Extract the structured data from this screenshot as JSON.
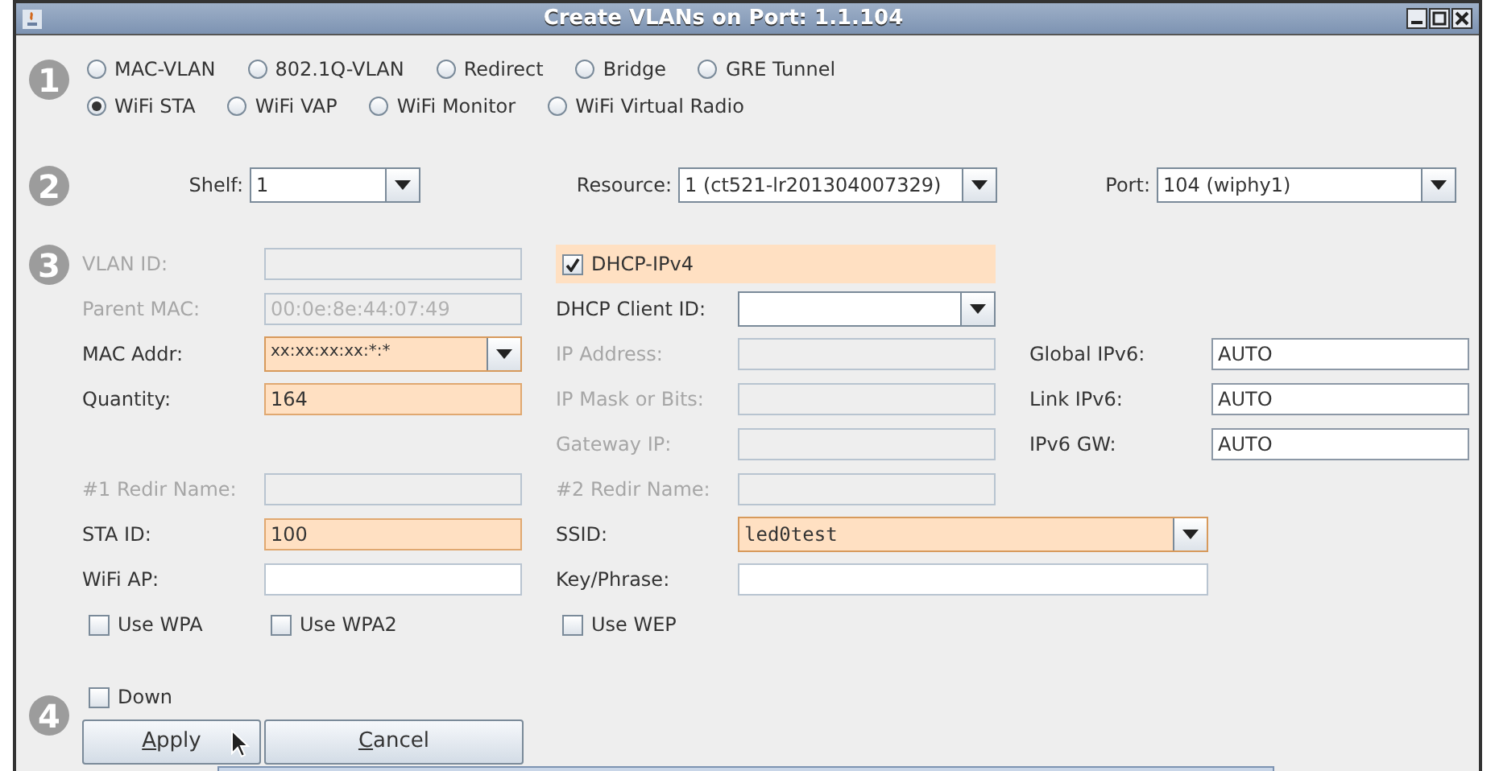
{
  "window": {
    "title": "Create VLANs on Port: 1.1.104"
  },
  "steps": [
    "1",
    "2",
    "3",
    "4"
  ],
  "type_rows": [
    [
      {
        "label": "MAC-VLAN",
        "selected": false
      },
      {
        "label": "802.1Q-VLAN",
        "selected": false
      },
      {
        "label": "Redirect",
        "selected": false
      },
      {
        "label": "Bridge",
        "selected": false
      },
      {
        "label": "GRE Tunnel",
        "selected": false
      }
    ],
    [
      {
        "label": "WiFi STA",
        "selected": true
      },
      {
        "label": "WiFi VAP",
        "selected": false
      },
      {
        "label": "WiFi Monitor",
        "selected": false
      },
      {
        "label": "WiFi Virtual Radio",
        "selected": false
      }
    ]
  ],
  "location": [
    {
      "label": "Shelf:",
      "value": "1"
    },
    {
      "label": "Resource:",
      "value": "1 (ct521-lr201304007329)"
    },
    {
      "label": "Port:",
      "value": "104 (wiphy1)"
    }
  ],
  "form_rows": [
    {
      "left": {
        "kind": "text",
        "label": "VLAN ID:",
        "disabled": true,
        "highlighted": false
      },
      "middle": {
        "kind": "checkbox",
        "label": "DHCP-IPv4",
        "checked": true,
        "highlighted": true
      }
    },
    {
      "left": {
        "kind": "text",
        "label": "Parent MAC:",
        "value": "00:0e:8e:44:07:49",
        "disabled": true,
        "highlighted": false
      },
      "middle": {
        "kind": "combo",
        "label": "DHCP Client ID:",
        "disabled": false,
        "highlighted": false
      }
    },
    {
      "left": {
        "kind": "combo",
        "label": "MAC Addr:",
        "value": "xx:xx:xx:xx:*:*",
        "disabled": false,
        "highlighted": true
      },
      "middle": {
        "kind": "text",
        "label": "IP Address:",
        "disabled": true,
        "highlighted": false
      },
      "right": {
        "kind": "text",
        "label": "Global IPv6:",
        "value": "AUTO",
        "disabled": false,
        "highlighted": false
      }
    },
    {
      "left": {
        "kind": "text",
        "label": "Quantity:",
        "value": "164",
        "disabled": false,
        "highlighted": true
      },
      "middle": {
        "kind": "text",
        "label": "IP Mask or Bits:",
        "disabled": true,
        "highlighted": false
      },
      "right": {
        "kind": "text",
        "label": "Link IPv6:",
        "value": "AUTO",
        "disabled": false,
        "highlighted": false
      }
    },
    {
      "middle": {
        "kind": "text",
        "label": "Gateway IP:",
        "disabled": true,
        "highlighted": false
      },
      "right": {
        "kind": "text",
        "label": "IPv6 GW:",
        "value": "AUTO",
        "disabled": false,
        "highlighted": false
      }
    },
    {
      "left": {
        "kind": "text",
        "label": "#1 Redir Name:",
        "disabled": true,
        "highlighted": false
      },
      "middle": {
        "kind": "text",
        "label": "#2 Redir Name:",
        "disabled": true,
        "highlighted": false
      }
    },
    {
      "left": {
        "kind": "text",
        "label": "STA ID:",
        "value": "100",
        "disabled": false,
        "highlighted": true
      },
      "middle": {
        "kind": "wide-combo",
        "label": "SSID:",
        "value": "led0test",
        "disabled": false,
        "highlighted": true
      }
    },
    {
      "left": {
        "kind": "text",
        "label": "WiFi AP:",
        "disabled": false,
        "highlighted": false
      },
      "middle": {
        "kind": "wide-text",
        "label": "Key/Phrase:",
        "disabled": false,
        "highlighted": false
      }
    }
  ],
  "security_options": [
    {
      "label": "Use WPA",
      "checked": false
    },
    {
      "label": "Use WPA2",
      "checked": false
    },
    {
      "label": "Use WEP",
      "checked": false
    }
  ],
  "down": {
    "label": "Down",
    "checked": false
  },
  "buttons": [
    {
      "label": "Apply",
      "mnemonic": true
    },
    {
      "label": "Cancel",
      "mnemonic": true
    }
  ]
}
